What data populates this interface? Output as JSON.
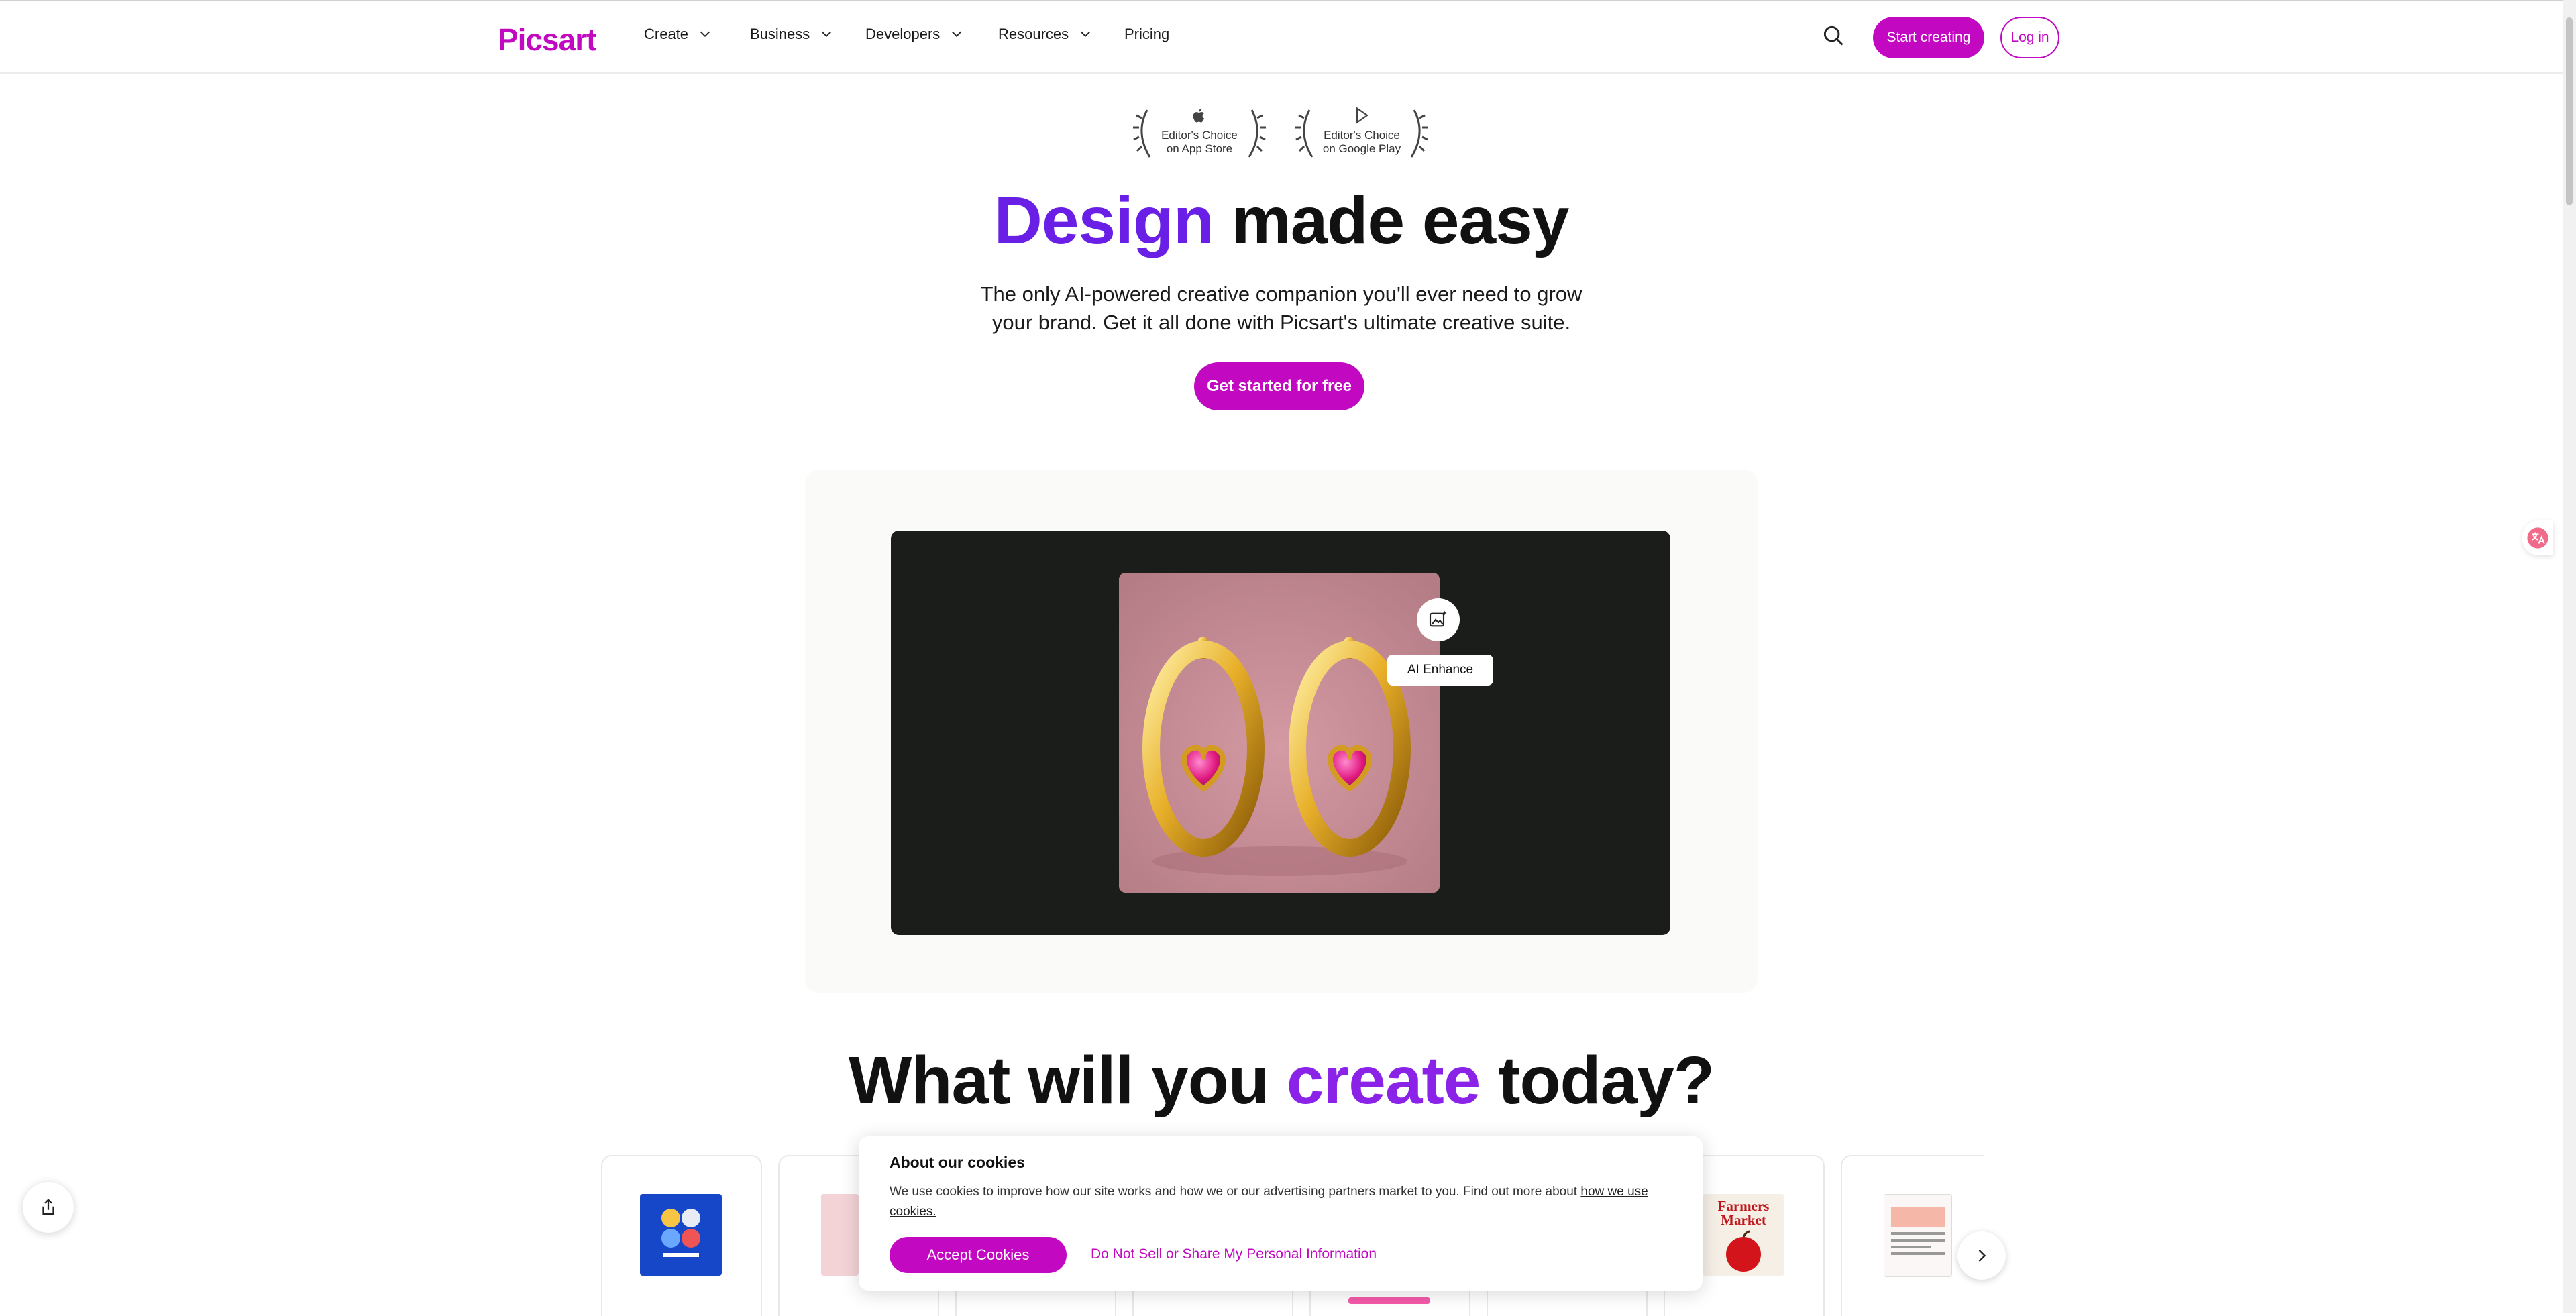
{
  "header": {
    "logo": "Picsart",
    "nav": [
      {
        "label": "Create",
        "has_menu": true
      },
      {
        "label": "Business",
        "has_menu": true
      },
      {
        "label": "Developers",
        "has_menu": true
      },
      {
        "label": "Resources",
        "has_menu": true
      },
      {
        "label": "Pricing",
        "has_menu": false
      }
    ],
    "search_icon": "search-icon",
    "start_label": "Start creating",
    "login_label": "Log in"
  },
  "awards": [
    {
      "line1": "Editor's Choice",
      "line2": "on App Store",
      "icon": "apple-icon"
    },
    {
      "line1": "Editor's Choice",
      "line2": "on Google Play",
      "icon": "play-icon"
    }
  ],
  "hero": {
    "title_accent": "Design",
    "title_rest": " made easy",
    "subtitle": "The only AI-powered creative companion you'll ever need to grow your brand. Get it all done with Picsart's ultimate creative suite.",
    "cta": "Get started for free"
  },
  "preview": {
    "tool_label": "AI Enhance",
    "tool_icon": "image-sparkle-icon"
  },
  "section": {
    "title_pre": "What will you ",
    "title_accent": "create",
    "title_post": " today?"
  },
  "templates": {
    "card4_text": "Farmers Market"
  },
  "cookie": {
    "title": "About our cookies",
    "body": "We use cookies to improve how our site works and how we or our advertising partners market to you. Find out more about ",
    "link": " how we use cookies.",
    "accept": "Accept Cookies",
    "dns": "Do Not Sell or Share My Personal Information"
  },
  "colors": {
    "brand": "#c209c1",
    "accent_purple": "#6a1fe6",
    "dark_panel": "#1b1d1a"
  }
}
